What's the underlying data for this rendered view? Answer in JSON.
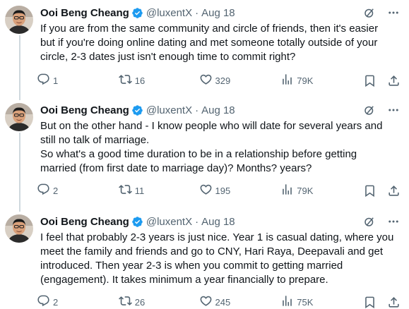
{
  "colors": {
    "name": "#0f1419",
    "muted": "#536471",
    "verified": "#1d9bf0",
    "thread_line": "#cfd9de"
  },
  "tweets": [
    {
      "author": "Ooi Beng Cheang",
      "handle": "@luxentX",
      "separator": "·",
      "date": "Aug 18",
      "lines": [
        "If you are from the same community and circle of friends, then it's easier",
        "but if you're doing online dating and met someone totally outside of your",
        "circle, 2-3 dates just isn't enough time to commit right?"
      ],
      "stats": {
        "replies": "1",
        "reposts": "16",
        "likes": "329",
        "views": "79K"
      }
    },
    {
      "author": "Ooi Beng Cheang",
      "handle": "@luxentX",
      "separator": "·",
      "date": "Aug 18",
      "lines": [
        "But on the other hand - I know people who will date for several years and",
        "still no talk of marriage.",
        "So what's a good time duration to be in a relationship before getting",
        "married (from first date to marriage day)? Months? years?"
      ],
      "stats": {
        "replies": "2",
        "reposts": "11",
        "likes": "195",
        "views": "79K"
      }
    },
    {
      "author": "Ooi Beng Cheang",
      "handle": "@luxentX",
      "separator": "·",
      "date": "Aug 18",
      "lines": [
        "I feel that probably 2-3 years is just nice. Year 1 is casual dating, where you",
        "meet the family and friends and go to CNY, Hari Raya, Deepavali and get",
        "introduced. Then year 2-3 is when you commit to getting married",
        "(engagement). It takes minimum a year financially to prepare."
      ],
      "stats": {
        "replies": "2",
        "reposts": "26",
        "likes": "245",
        "views": "75K"
      }
    }
  ]
}
